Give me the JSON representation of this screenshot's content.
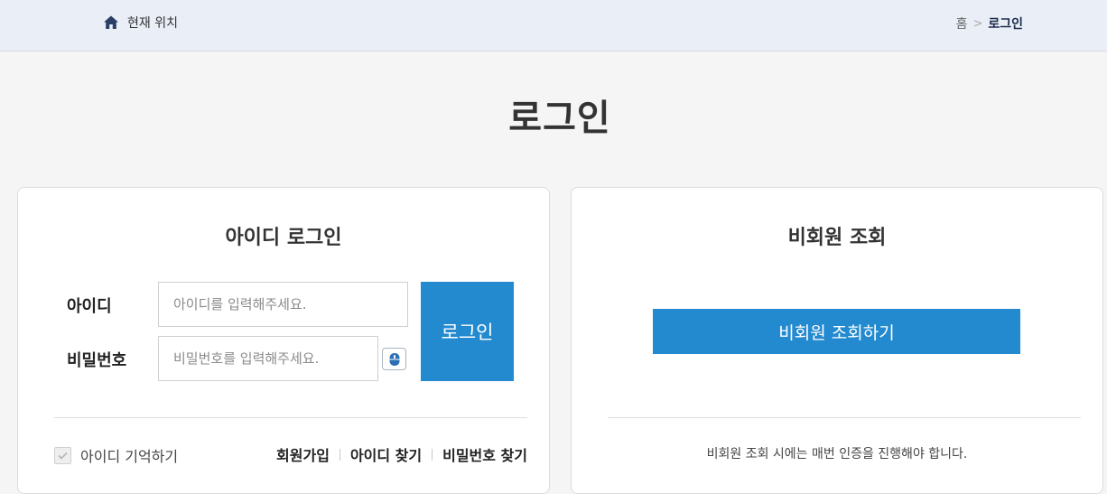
{
  "location": {
    "label": "현재 위치",
    "icon": "home-icon"
  },
  "breadcrumb": {
    "home": "홈",
    "separator": ">",
    "current": "로그인"
  },
  "page_title": "로그인",
  "member_login": {
    "title": "아이디 로그인",
    "id_label": "아이디",
    "id_placeholder": "아이디를 입력해주세요.",
    "pw_label": "비밀번호",
    "pw_placeholder": "비밀번호를 입력해주세요.",
    "keyboard_icon": "mouse-keyboard-icon",
    "login_button": "로그인",
    "remember_label": "아이디 기억하기",
    "links": [
      "회원가입",
      "아이디 찾기",
      "비밀번호 찾기"
    ]
  },
  "guest": {
    "title": "비회원 조회",
    "button": "비회원 조회하기",
    "note": "비회원 조회 시에는 매번 인증을 진행해야 합니다."
  },
  "colors": {
    "accent": "#238ad0",
    "topbar": "#e9eef7",
    "background": "#f5f5f5"
  }
}
